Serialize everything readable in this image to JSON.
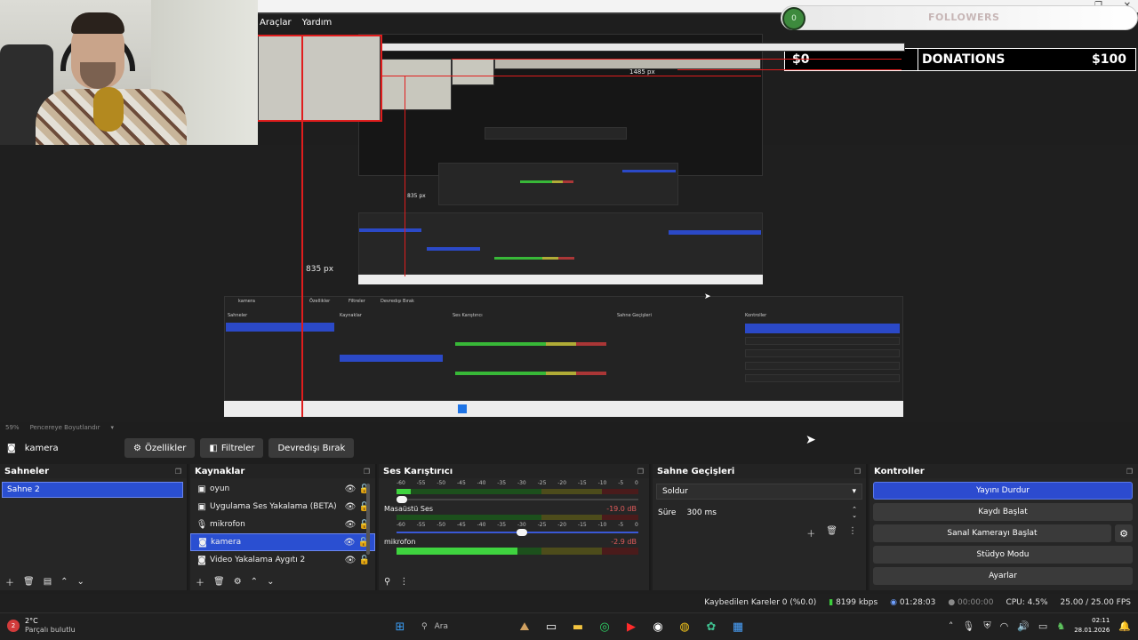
{
  "menu": {
    "items": [
      "Araçlar",
      "Yardım"
    ]
  },
  "overlay": {
    "followers_label": "FOLLOWERS",
    "followers_count": "0",
    "donations_amount_left": "$0",
    "donations_label": "DONATIONS",
    "donations_amount_right": "$100"
  },
  "preview": {
    "px_label_height": "835 px",
    "px_label_small": "835 px",
    "px_label_width": "1485 px",
    "zoom": "59%",
    "resize_label": "Pencereye Boyutlandır"
  },
  "sourcebar": {
    "source_name": "kamera",
    "properties": "Özellikler",
    "filters": "Filtreler",
    "deactivate": "Devredışı Bırak"
  },
  "scenes": {
    "title": "Sahneler",
    "items": [
      {
        "label": "Sahne 2",
        "selected": true
      }
    ]
  },
  "sources": {
    "title": "Kaynaklar",
    "items": [
      {
        "icon": "game-capture-icon",
        "label": "oyun"
      },
      {
        "icon": "app-audio-icon",
        "label": "Uygulama Ses Yakalama (BETA)"
      },
      {
        "icon": "microphone-icon",
        "label": "mikrofon"
      },
      {
        "icon": "camera-icon",
        "label": "kamera",
        "selected": true
      },
      {
        "icon": "camera-icon",
        "label": "Video Yakalama Aygıtı 2"
      }
    ]
  },
  "mixer": {
    "title": "Ses Karıştırıcı",
    "scale": [
      "-60",
      "-55",
      "-50",
      "-45",
      "-40",
      "-35",
      "-30",
      "-25",
      "-20",
      "-15",
      "-10",
      "-5",
      "0"
    ],
    "channels": [
      {
        "name": "",
        "db": "",
        "level": 0.06,
        "volume": 0.0
      },
      {
        "name": "Masaüstü Ses",
        "db": "-19.0 dB",
        "level": 0.0,
        "volume": 0.52
      },
      {
        "name": "mikrofon",
        "db": "-2.9 dB",
        "level": 0.5,
        "volume": 0.0
      }
    ]
  },
  "transitions": {
    "title": "Sahne Geçişleri",
    "selected": "Soldur",
    "duration_label": "Süre",
    "duration_value": "300 ms"
  },
  "controls": {
    "title": "Kontroller",
    "stop_stream": "Yayını Durdur",
    "start_record": "Kaydı Başlat",
    "virtual_camera": "Sanal Kamerayı Başlat",
    "studio_mode": "Stüdyo Modu",
    "settings": "Ayarlar"
  },
  "status": {
    "dropped_frames": "Kaybedilen Kareler 0 (%0.0)",
    "bitrate": "8199 kbps",
    "stream_time": "01:28:03",
    "record_time": "00:00:00",
    "cpu": "CPU: 4.5%",
    "fps": "25.00 / 25.00 FPS"
  },
  "taskbar": {
    "weather_badge": "2",
    "temperature": "2°C",
    "condition": "Parçalı bulutlu",
    "search": "Ara",
    "time": "02:11",
    "date": "28.01.2026"
  },
  "colors": {
    "accent_blue": "#2a4fd1",
    "danger_red": "#e01d1d",
    "meter_green": "#3fd33f"
  }
}
